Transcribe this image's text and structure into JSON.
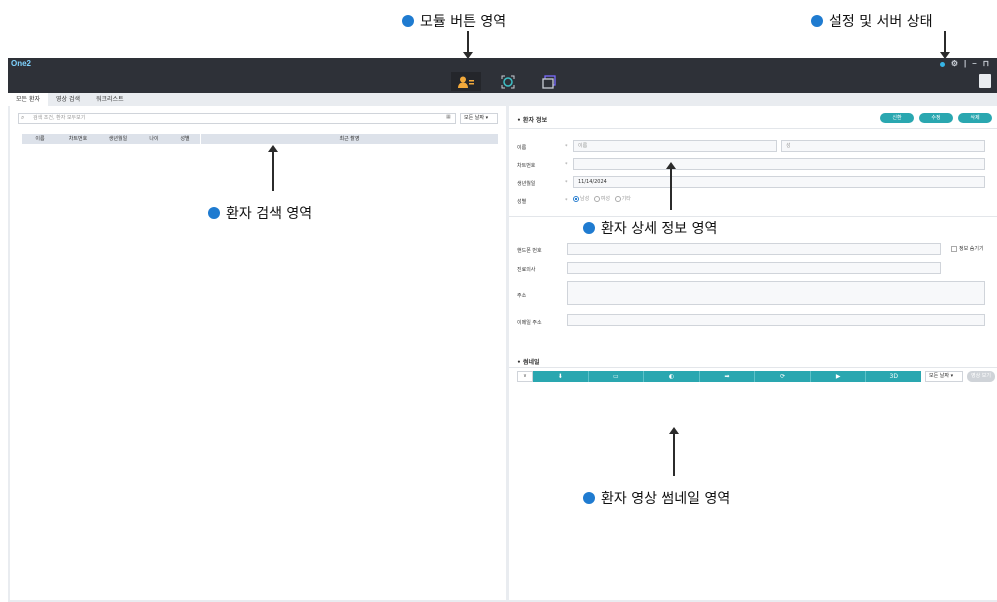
{
  "annotations": {
    "module_area": "모듈 버튼 영역",
    "settings_server": "설정 및 서버 상태",
    "patient_search": "환자 검색 영역",
    "patient_detail": "환자 상세 정보 영역",
    "patient_thumbnail": "환자 영상 썸네일 영역"
  },
  "app": {
    "title": "One2",
    "window_controls": [
      "●",
      "⚙",
      "|",
      "–",
      "⊓"
    ]
  },
  "modules": [
    {
      "icon": "patient-icon",
      "active": true
    },
    {
      "icon": "scan-icon",
      "active": false
    },
    {
      "icon": "gallery-icon",
      "active": false
    }
  ],
  "tabs": [
    "모든 환자",
    "영상 검색",
    "워크리스트"
  ],
  "search": {
    "placeholder": "검색 조건, 환자 모두보기",
    "period": "모든 날짜"
  },
  "table_headers": [
    "이름",
    "차트번호",
    "생년월일",
    "나이",
    "성별",
    "최근 촬영"
  ],
  "detail": {
    "section_title": "• 환자 정보",
    "buttons": [
      "신환",
      "수정",
      "삭제"
    ],
    "name_label": "이름",
    "name_placeholder": "이름",
    "surname_placeholder": "성",
    "chart_label": "차트번호",
    "birth_label": "생년월일",
    "birth_value": "11/14/2024",
    "gender_label": "성별",
    "gender_options": [
      "남성",
      "여성",
      "기타"
    ],
    "phone_label": "핸드폰 번호",
    "hide_info": "정보 숨기기",
    "doctor_label": "진료의사",
    "address_label": "주소",
    "email_label": "이메일 주소"
  },
  "thumbnail": {
    "section_title": "• 썸네일",
    "toggle": "∨",
    "toolbar_items": [
      "⬇",
      "▭",
      "◐",
      "➡",
      "⟳",
      "▶",
      "3D"
    ],
    "period": "모든 날짜",
    "view_button": "영상 보기"
  }
}
